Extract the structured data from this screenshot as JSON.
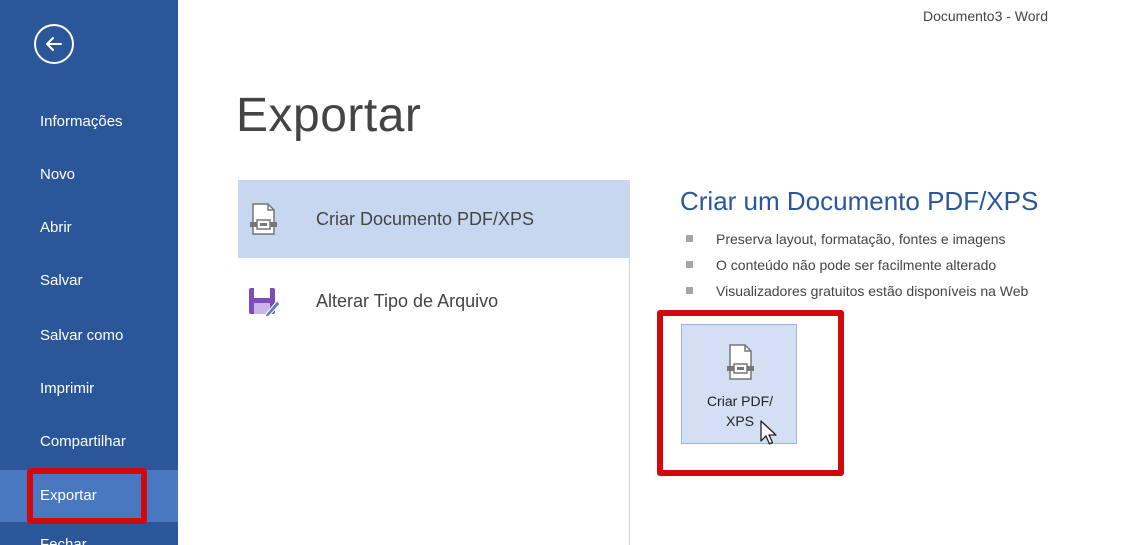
{
  "window": {
    "title": "Documento3 - Word"
  },
  "sidebar": {
    "back_icon": "back-arrow-icon",
    "items": [
      {
        "label": "Informações"
      },
      {
        "label": "Novo"
      },
      {
        "label": "Abrir"
      },
      {
        "label": "Salvar"
      },
      {
        "label": "Salvar como"
      },
      {
        "label": "Imprimir"
      },
      {
        "label": "Compartilhar"
      },
      {
        "label": "Exportar",
        "active": true
      },
      {
        "label": "Fechar"
      }
    ]
  },
  "main": {
    "title": "Exportar",
    "options": [
      {
        "label": "Criar Documento PDF/XPS",
        "icon": "pdf-document-icon",
        "selected": true
      },
      {
        "label": "Alterar Tipo de Arquivo",
        "icon": "save-file-type-icon"
      }
    ],
    "detail": {
      "title": "Criar um Documento PDF/XPS",
      "bullets": [
        "Preserva layout, formatação, fontes e imagens",
        "O conteúdo não pode ser facilmente alterado",
        "Visualizadores gratuitos estão disponíveis na Web"
      ],
      "button": {
        "line1": "Criar PDF/",
        "line2": "XPS"
      }
    }
  },
  "colors": {
    "sidebar_bg": "#2b579a",
    "sidebar_active": "#4a78c0",
    "selected_option": "#c7d7ef",
    "accent_title": "#2b579a",
    "highlight": "#d00a0a"
  }
}
